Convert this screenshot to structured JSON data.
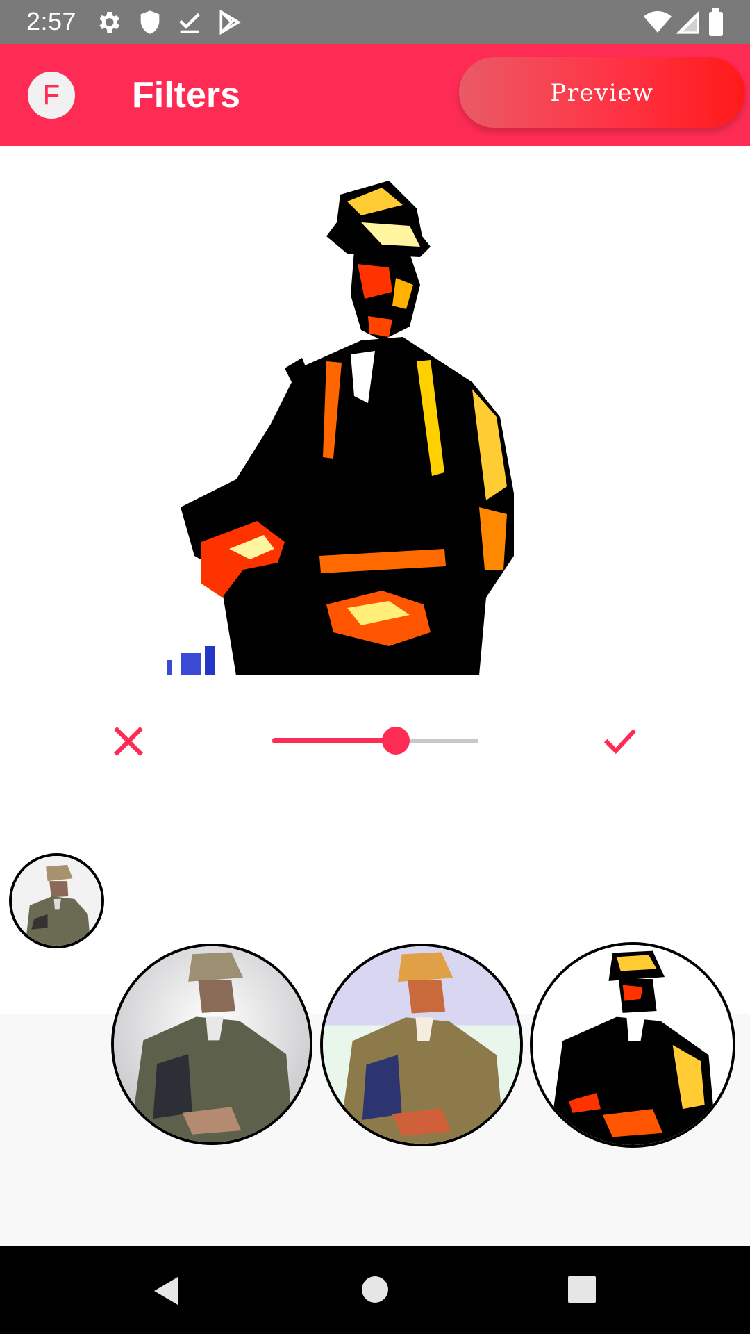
{
  "status_bar": {
    "time": "2:57",
    "left_icons": [
      "settings-icon",
      "shield-icon",
      "download-done-icon",
      "play-store-icon"
    ],
    "right_icons": [
      "wifi-icon",
      "cell-signal-icon",
      "battery-icon"
    ]
  },
  "app_bar": {
    "avatar_letter": "F",
    "title": "Filters",
    "preview_label": "Preview",
    "color": "#fe2c55"
  },
  "editor": {
    "cancel_icon": "close-icon",
    "confirm_icon": "check-icon",
    "intensity": 0.6
  },
  "filters": [
    {
      "name": "original",
      "selected": false
    },
    {
      "name": "grayscale",
      "selected": false
    },
    {
      "name": "warm",
      "selected": false
    },
    {
      "name": "posterize",
      "selected": true
    }
  ],
  "nav_bar": [
    "back-icon",
    "home-icon",
    "recents-icon"
  ]
}
